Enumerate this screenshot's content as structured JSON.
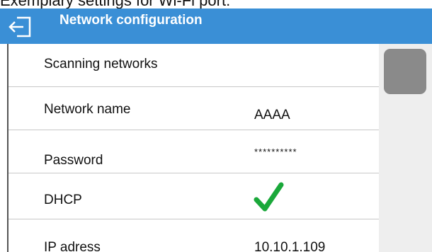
{
  "caption": "Exemplary settings for Wi-Fi port:",
  "header": {
    "title": "Network configuration",
    "back_icon": "logout-arrow-icon",
    "background_color": "#3a8fd6"
  },
  "rows": [
    {
      "label": "Scanning networks",
      "value": ""
    },
    {
      "label": "Network name",
      "value": "AAAA"
    },
    {
      "label": "Password",
      "value": "**********"
    },
    {
      "label": "DHCP",
      "value_icon": "checkmark-icon",
      "value_color": "#1aa83a"
    },
    {
      "label": "IP adress",
      "value": "10.10.1.109"
    }
  ],
  "scrollbar": {
    "thumb_color": "#8a8a8a"
  }
}
